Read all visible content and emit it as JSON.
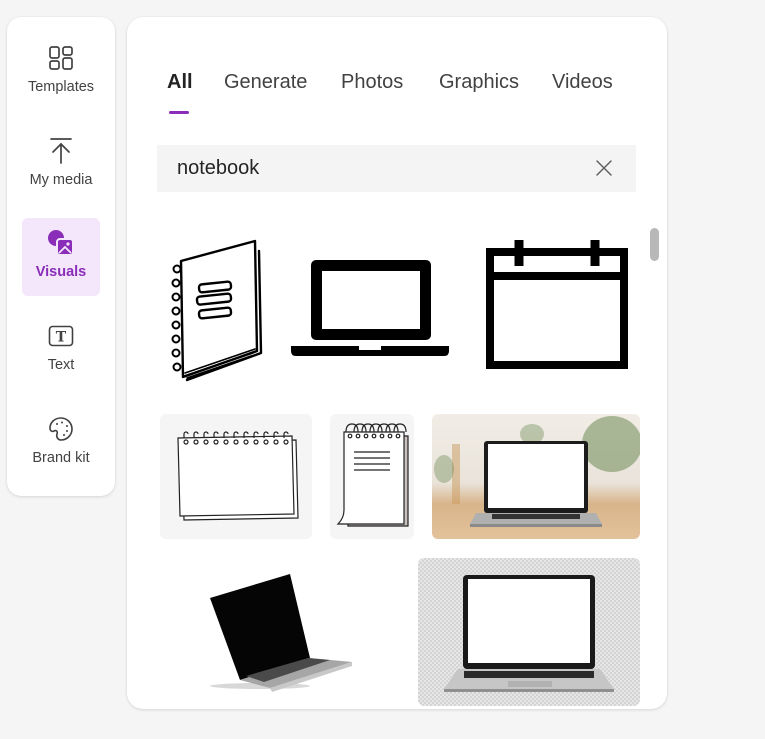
{
  "sidebar": {
    "items": [
      {
        "label": "Templates",
        "icon": "templates-icon",
        "active": false
      },
      {
        "label": "My media",
        "icon": "upload-icon",
        "active": false
      },
      {
        "label": "Visuals",
        "icon": "visuals-icon",
        "active": true
      },
      {
        "label": "Text",
        "icon": "text-icon",
        "active": false
      },
      {
        "label": "Brand kit",
        "icon": "palette-icon",
        "active": false
      }
    ]
  },
  "tabs": [
    {
      "label": "All",
      "active": true
    },
    {
      "label": "Generate",
      "active": false
    },
    {
      "label": "Photos",
      "active": false
    },
    {
      "label": "Graphics",
      "active": false
    },
    {
      "label": "Videos",
      "active": false
    }
  ],
  "search": {
    "value": "notebook",
    "clear_icon": "close-icon"
  },
  "results": [
    {
      "kind": "graphic",
      "description": "hand-drawn spiral notebook"
    },
    {
      "kind": "graphic",
      "description": "laptop icon"
    },
    {
      "kind": "graphic",
      "description": "calendar icon"
    },
    {
      "kind": "graphic",
      "description": "landscape spiral notepad"
    },
    {
      "kind": "graphic",
      "description": "portrait spiral notepad with lines"
    },
    {
      "kind": "photo",
      "description": "laptop on wooden desk in office"
    },
    {
      "kind": "photo",
      "description": "tilted open laptop with black screen"
    },
    {
      "kind": "photo",
      "description": "laptop with blank white screen, transparent background"
    }
  ],
  "colors": {
    "accent": "#8a2db8",
    "active_bg": "#f4e6fb"
  }
}
